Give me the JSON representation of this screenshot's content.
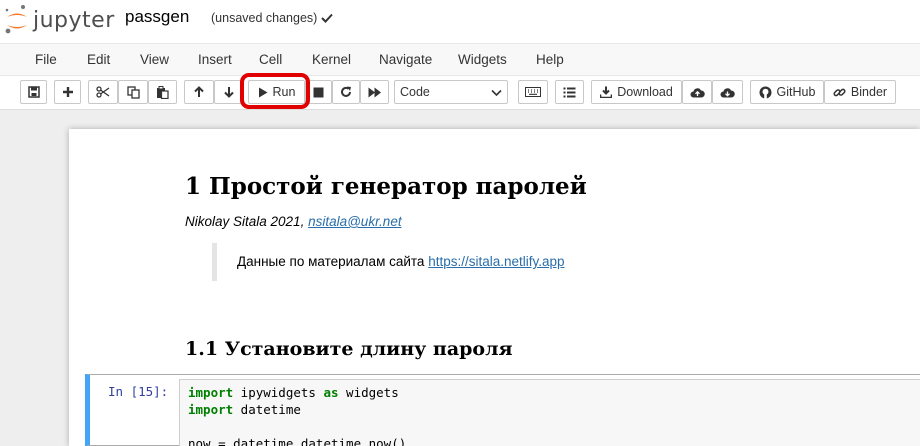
{
  "header": {
    "logo_text": "jupyter",
    "notebook_name": "passgen",
    "save_status": "(unsaved changes)"
  },
  "menubar": {
    "items": [
      "File",
      "Edit",
      "View",
      "Insert",
      "Cell",
      "Kernel",
      "Navigate",
      "Widgets",
      "Help"
    ]
  },
  "toolbar": {
    "run_label": "Run",
    "cell_type": "Code",
    "download_label": "Download",
    "github_label": "GitHub",
    "binder_label": "Binder"
  },
  "notebook": {
    "h1": "1  Простой генератор паролей",
    "author_text": "Nikolay Sitala 2021, ",
    "author_email": "nsitala@ukr.net",
    "quote_text": "Данные по материалам сайта ",
    "quote_link": "https://sitala.netlify.app",
    "h2": "1.1  Установите длину пароля",
    "prompt": "In [15]:",
    "code": {
      "line1_kw1": "import",
      "line1_a": " ipywidgets ",
      "line1_kw2": "as",
      "line1_b": " widgets",
      "line2_kw": "import",
      "line2_a": " datetime",
      "line4": "now = datetime.datetime.now()"
    }
  }
}
